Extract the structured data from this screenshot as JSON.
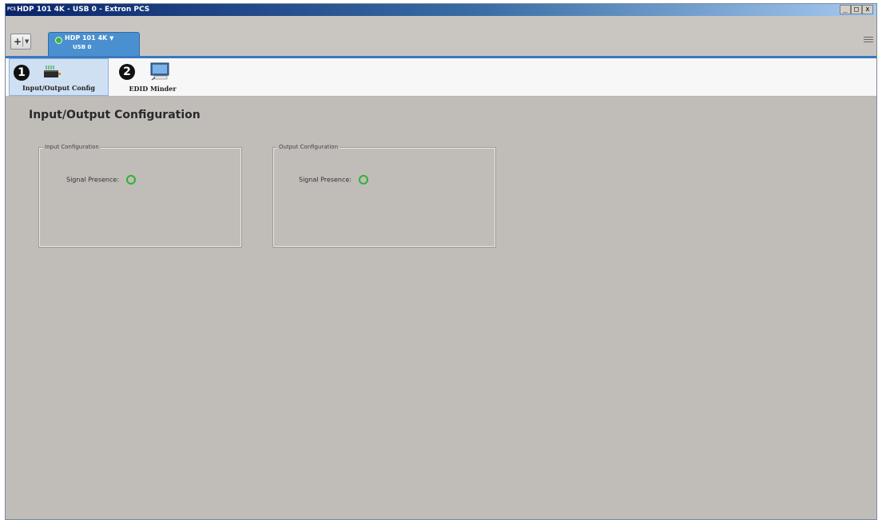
{
  "window": {
    "title": "HDP 101 4K - USB 0 - Extron PCS",
    "app_icon_text": "PCS",
    "controls": {
      "minimize": "_",
      "maximize": "□",
      "close": "x"
    }
  },
  "tabbar": {
    "add_symbol": "+",
    "add_dropdown": "▼",
    "device_tab": {
      "name": "HDP 101 4K",
      "dropdown": "▼",
      "port": "USB 0",
      "status_color": "#3db53d"
    }
  },
  "toolbar": {
    "items": [
      {
        "number": "1",
        "label": "Input/Output Config",
        "selected": true,
        "icon": "io-config-icon"
      },
      {
        "number": "2",
        "label": "EDID Minder",
        "selected": false,
        "icon": "edid-monitor-icon"
      }
    ]
  },
  "main": {
    "page_title": "Input/Output Configuration",
    "input_group": {
      "title": "Input Configuration",
      "signal_label": "Signal Presence:"
    },
    "output_group": {
      "title": "Output Configuration",
      "signal_label": "Signal Presence:"
    }
  },
  "colors": {
    "accent": "#3a78c0",
    "background": "#c0bdb9",
    "signal_led": "#2fb12f"
  }
}
